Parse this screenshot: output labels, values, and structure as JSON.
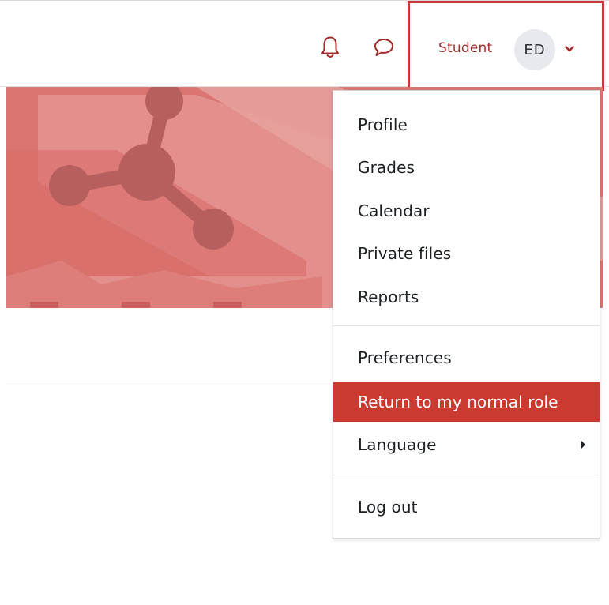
{
  "navbar": {
    "notifications_icon": "bell-icon",
    "messages_icon": "chat-bubble-icon",
    "user_menu": {
      "role": "Student",
      "initials": "ED",
      "caret_icon": "chevron-down-icon"
    }
  },
  "banner": {
    "color": "#db7572",
    "image": "molecule-illustration"
  },
  "dropdown": {
    "items": [
      {
        "label": "Profile"
      },
      {
        "label": "Grades"
      },
      {
        "label": "Calendar"
      },
      {
        "label": "Private files"
      },
      {
        "label": "Reports"
      },
      {
        "label": "Preferences"
      },
      {
        "label": "Return to my normal role",
        "active": true
      },
      {
        "label": "Language",
        "has_submenu": true
      },
      {
        "label": "Log out"
      }
    ]
  },
  "colors": {
    "accent": "#ca3a30",
    "highlight_border": "#ca3939",
    "role_text": "#a52a2a"
  }
}
